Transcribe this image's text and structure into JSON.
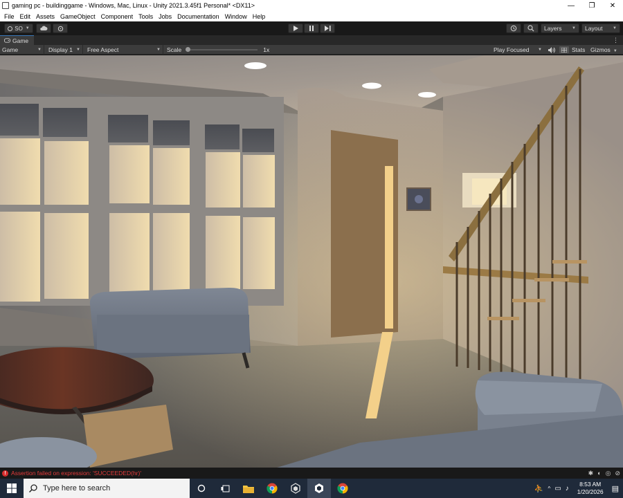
{
  "window": {
    "title": "gaming pc - buildinggame - Windows, Mac, Linux - Unity 2021.3.45f1 Personal* <DX11>",
    "minimize_glyph": "—",
    "restore_glyph": "❐",
    "close_glyph": "✕"
  },
  "menu": [
    "File",
    "Edit",
    "Assets",
    "GameObject",
    "Component",
    "Tools",
    "Jobs",
    "Documentation",
    "Window",
    "Help"
  ],
  "toolbar": {
    "account_label": "SO",
    "layers_label": "Layers",
    "layout_label": "Layout"
  },
  "tab": {
    "label": "Game"
  },
  "gamebar": {
    "mode": "Game",
    "display": "Display 1",
    "aspect": "Free Aspect",
    "scale_label": "Scale",
    "scale_value": "1x",
    "scale_fraction": 0.0,
    "play_mode": "Play Focused",
    "stats_label": "Stats",
    "gizmos_label": "Gizmos"
  },
  "console": {
    "message": "Assertion failed on expression: 'SUCCEEDED(hr)'",
    "error_glyph": "!"
  },
  "taskbar": {
    "search_placeholder": "Type here to search",
    "time": "8:53 AM",
    "date": "1/20/2026",
    "apps": [
      "task-view-icon",
      "file-explorer-icon",
      "chrome-icon",
      "unity-hub-icon",
      "unity-icon",
      "chrome-icon"
    ]
  },
  "colors": {
    "unity_dark": "#191919",
    "panel": "#3c3c3c",
    "error": "#e33a3a",
    "sunlight": "#f3d08a",
    "taskbar": "#1f2a3a"
  }
}
